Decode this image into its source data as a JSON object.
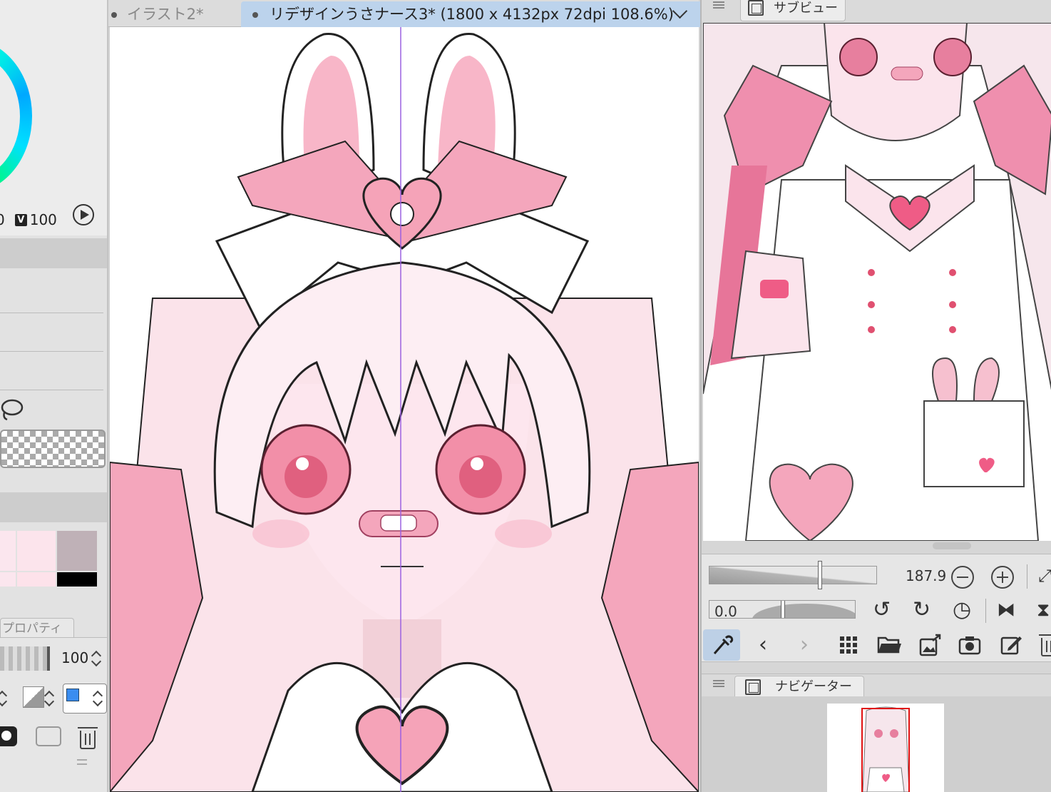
{
  "canvas_tabs": [
    {
      "label": "イラスト2*",
      "active": false
    },
    {
      "label": "リデザインうさナース3* (1800 x 4132px 72dpi 108.6%)",
      "active": true
    }
  ],
  "color_panel": {
    "v_badge": "V",
    "v_value": "100",
    "cut_value": "0"
  },
  "layer_property": {
    "tab_label": "プロパティ",
    "opacity": "100"
  },
  "subview": {
    "tab_label": "サブビュー"
  },
  "subview_controls": {
    "zoom": "187.9",
    "rotation": "0.0"
  },
  "navigator": {
    "tab_label": "ナビゲーター"
  },
  "colors": {
    "tab_active": "#bcd3ec",
    "tool_active": "#bdd0e6",
    "pink": "#f4a6bc",
    "pink_dark": "#e9809f",
    "navigator_frame": "#e01010",
    "layer_color": "#3a8df0"
  },
  "icons": [
    "play-icon",
    "lasso-icon",
    "mask-icon",
    "camera-icon",
    "trash-icon",
    "eyedropper-icon",
    "chevron-left-icon",
    "chevron-right-icon",
    "grid-icon",
    "folder-open-icon",
    "import-icon",
    "camera-icon",
    "edit-icon",
    "zoom-out-icon",
    "zoom-in-icon",
    "rotate-left-icon",
    "rotate-right-icon",
    "reset-rotation-icon",
    "flip-horizontal-icon"
  ]
}
